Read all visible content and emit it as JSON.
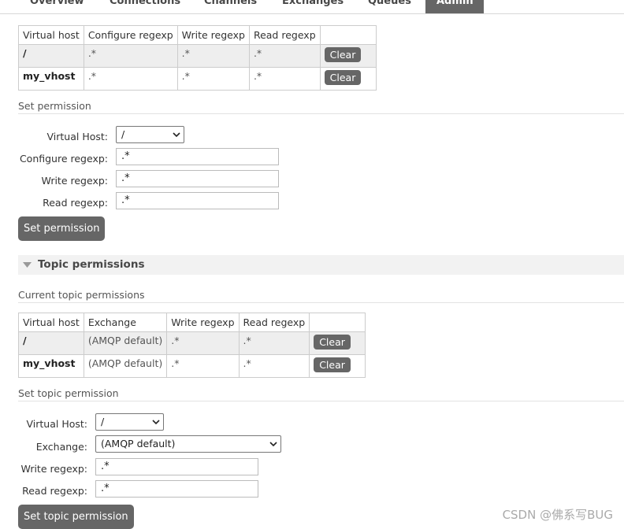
{
  "nav": {
    "tabs": [
      {
        "label": "Overview"
      },
      {
        "label": "Connections"
      },
      {
        "label": "Channels"
      },
      {
        "label": "Exchanges"
      },
      {
        "label": "Queues"
      },
      {
        "label": "Admin"
      }
    ],
    "active": "Admin"
  },
  "permissions_table": {
    "headers": [
      "Virtual host",
      "Configure regexp",
      "Write regexp",
      "Read regexp",
      ""
    ],
    "rows": [
      {
        "vhost": "/",
        "configure": ".*",
        "write": ".*",
        "read": ".*",
        "action": "Clear"
      },
      {
        "vhost": "my_vhost",
        "configure": ".*",
        "write": ".*",
        "read": ".*",
        "action": "Clear"
      }
    ]
  },
  "set_permission": {
    "heading": "Set permission",
    "vhost_label": "Virtual Host:",
    "vhost_value": "/",
    "configure_label": "Configure regexp:",
    "configure_value": ".*",
    "write_label": "Write regexp:",
    "write_value": ".*",
    "read_label": "Read regexp:",
    "read_value": ".*",
    "button": "Set permission"
  },
  "topic_section": {
    "title": "Topic permissions",
    "current_heading": "Current topic permissions"
  },
  "topic_table": {
    "headers": [
      "Virtual host",
      "Exchange",
      "Write regexp",
      "Read regexp",
      ""
    ],
    "rows": [
      {
        "vhost": "/",
        "exchange": "(AMQP default)",
        "write": ".*",
        "read": ".*",
        "action": "Clear"
      },
      {
        "vhost": "my_vhost",
        "exchange": "(AMQP default)",
        "write": ".*",
        "read": ".*",
        "action": "Clear"
      }
    ]
  },
  "set_topic_permission": {
    "heading": "Set topic permission",
    "vhost_label": "Virtual Host:",
    "vhost_value": "/",
    "exchange_label": "Exchange:",
    "exchange_value": "(AMQP default)",
    "write_label": "Write regexp:",
    "write_value": ".*",
    "read_label": "Read regexp:",
    "read_value": ".*",
    "button": "Set topic permission"
  },
  "watermark": "CSDN @佛系写BUG"
}
